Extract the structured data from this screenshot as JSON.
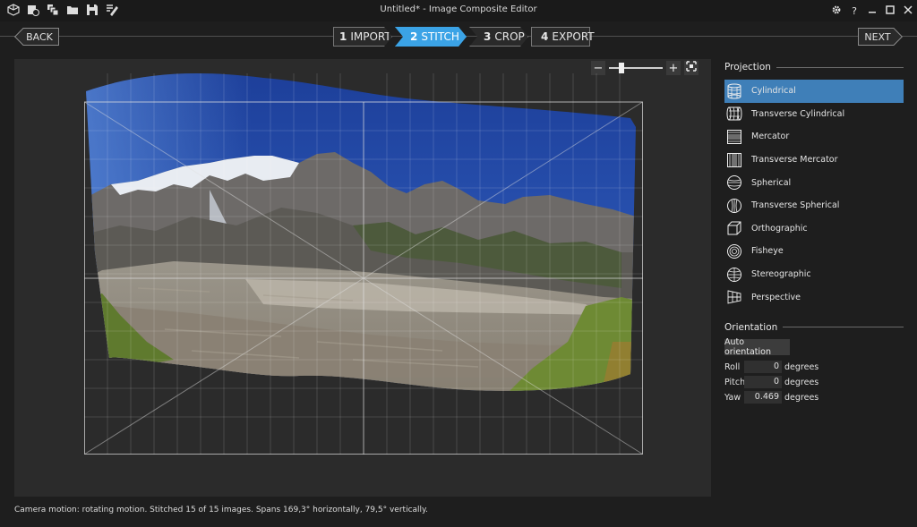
{
  "window": {
    "title": "Untitled* - Image Composite Editor",
    "settings_icon": "gear-icon",
    "help_label": "?"
  },
  "nav": {
    "back_label": "BACK",
    "next_label": "NEXT",
    "steps": [
      {
        "num": "1",
        "label": "IMPORT"
      },
      {
        "num": "2",
        "label": "STITCH"
      },
      {
        "num": "3",
        "label": "CROP"
      },
      {
        "num": "4",
        "label": "EXPORT"
      }
    ],
    "active_step": "STITCH",
    "accent": "#3ba3e6"
  },
  "zoom": {
    "minus_label": "−",
    "plus_label": "+",
    "level": 0.2
  },
  "projection": {
    "title": "Projection",
    "selected": "Cylindrical",
    "items": [
      {
        "label": "Cylindrical",
        "icon": "cylindrical-icon"
      },
      {
        "label": "Transverse Cylindrical",
        "icon": "transverse-cylindrical-icon"
      },
      {
        "label": "Mercator",
        "icon": "mercator-icon"
      },
      {
        "label": "Transverse Mercator",
        "icon": "transverse-mercator-icon"
      },
      {
        "label": "Spherical",
        "icon": "spherical-icon"
      },
      {
        "label": "Transverse Spherical",
        "icon": "transverse-spherical-icon"
      },
      {
        "label": "Orthographic",
        "icon": "orthographic-icon"
      },
      {
        "label": "Fisheye",
        "icon": "fisheye-icon"
      },
      {
        "label": "Stereographic",
        "icon": "stereographic-icon"
      },
      {
        "label": "Perspective",
        "icon": "perspective-icon"
      }
    ]
  },
  "orientation": {
    "title": "Orientation",
    "auto_label": "Auto orientation",
    "params": [
      {
        "label": "Roll",
        "value": "0",
        "unit": "degrees"
      },
      {
        "label": "Pitch",
        "value": "0",
        "unit": "degrees"
      },
      {
        "label": "Yaw",
        "value": "0.469",
        "unit": "degrees"
      }
    ]
  },
  "status": {
    "text": "Camera motion: rotating motion. Stitched 15 of 15 images. Spans 169,3° horizontally, 79,5° vertically."
  }
}
